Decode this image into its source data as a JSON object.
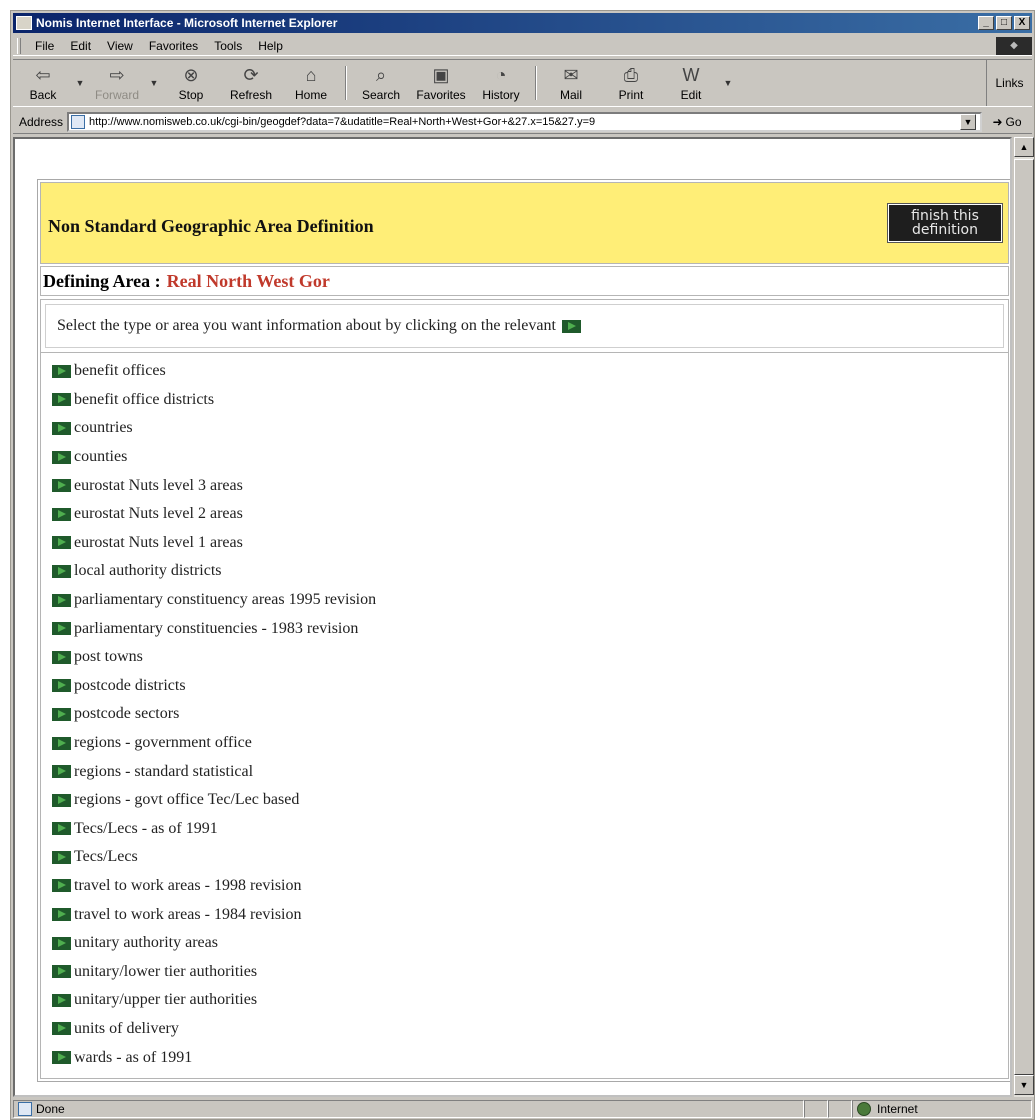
{
  "window": {
    "title": "Nomis Internet Interface - Microsoft Internet Explorer",
    "controls": [
      "_",
      "□",
      "X"
    ]
  },
  "menu": [
    "File",
    "Edit",
    "View",
    "Favorites",
    "Tools",
    "Help"
  ],
  "toolbar": {
    "buttons": [
      {
        "label": "Back",
        "icon": "back-arrow-icon",
        "enabled": true
      },
      {
        "label": "Forward",
        "icon": "forward-arrow-icon",
        "enabled": false
      },
      {
        "label": "Stop",
        "icon": "stop-icon",
        "enabled": true
      },
      {
        "label": "Refresh",
        "icon": "refresh-icon",
        "enabled": true
      },
      {
        "label": "Home",
        "icon": "home-icon",
        "enabled": true
      },
      {
        "label": "Search",
        "icon": "search-icon",
        "enabled": true
      },
      {
        "label": "Favorites",
        "icon": "favorites-icon",
        "enabled": true
      },
      {
        "label": "History",
        "icon": "history-icon",
        "enabled": true
      },
      {
        "label": "Mail",
        "icon": "mail-icon",
        "enabled": true
      },
      {
        "label": "Print",
        "icon": "print-icon",
        "enabled": true
      },
      {
        "label": "Edit",
        "icon": "edit-icon",
        "enabled": true
      }
    ],
    "links_label": "Links"
  },
  "address": {
    "label": "Address",
    "url": "http://www.nomisweb.co.uk/cgi-bin/geogdef?data=7&udatitle=Real+North+West+Gor+&27.x=15&27.y=9",
    "go_label": "Go"
  },
  "page": {
    "title": "Non Standard Geographic Area Definition",
    "finish_button": [
      "finish this",
      "definition"
    ],
    "defining_label": "Defining Area :",
    "defining_value": "Real North West Gor",
    "instruction": "Select the type or area you want information about by clicking on the relevant",
    "area_types": [
      "benefit offices",
      "benefit office districts",
      "countries",
      "counties",
      "eurostat Nuts level 3 areas",
      "eurostat Nuts level 2 areas",
      "eurostat Nuts level 1 areas",
      "local authority districts",
      "parliamentary constituency areas 1995 revision",
      "parliamentary constituencies - 1983 revision",
      "post towns",
      "postcode districts",
      "postcode sectors",
      "regions - government office",
      "regions - standard statistical",
      "regions - govt office Tec/Lec based",
      "Tecs/Lecs - as of 1991",
      "Tecs/Lecs",
      "travel to work areas - 1998 revision",
      "travel to work areas - 1984 revision",
      "unitary authority areas",
      "unitary/lower tier authorities",
      "unitary/upper tier authorities",
      "units of delivery",
      "wards - as of 1991"
    ]
  },
  "status": {
    "text": "Done",
    "zone": "Internet"
  }
}
